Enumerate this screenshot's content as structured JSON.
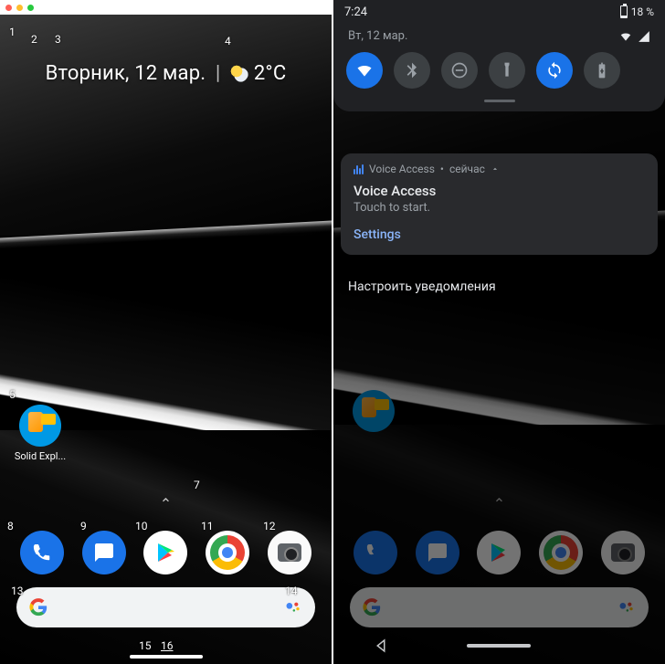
{
  "left": {
    "date_text": "Вторник, 12 мар.",
    "temp": "2°C",
    "app_solid_label": "Solid Expl...",
    "numbers": {
      "n1": "1",
      "n2": "2",
      "n3": "3",
      "n4": "4",
      "n5": "5",
      "n7": "7",
      "n8": "8",
      "n9": "9",
      "n10": "10",
      "n11": "11",
      "n12": "12",
      "n13": "13",
      "n14": "14",
      "n15": "15",
      "n16": "16"
    }
  },
  "right": {
    "status_time": "7:24",
    "battery_text": "18 %",
    "shade_date": "Вт, 12 мар.",
    "notif": {
      "app": "Voice Access",
      "sep": " • ",
      "time": "сейчас",
      "title": "Voice Access",
      "body": "Touch to start.",
      "settings": "Settings"
    },
    "manage": "Настроить уведомления"
  }
}
